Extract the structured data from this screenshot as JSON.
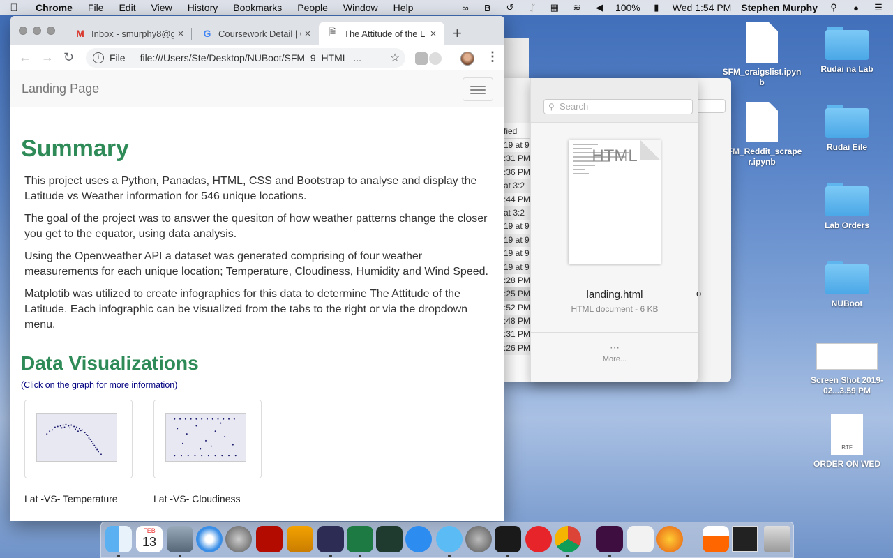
{
  "menubar": {
    "app": "Chrome",
    "items": [
      "File",
      "Edit",
      "View",
      "History",
      "Bookmarks",
      "People",
      "Window",
      "Help"
    ],
    "battery": "100%",
    "clock": "Wed 1:54 PM",
    "user": "Stephen Murphy"
  },
  "browser": {
    "tabs": [
      {
        "title": "Inbox - smurphy8@g",
        "icon": "gmail-icon"
      },
      {
        "title": "Coursework Detail | C",
        "icon": "google-icon"
      },
      {
        "title": "The Attitude of the L",
        "icon": "document-icon"
      }
    ],
    "omnibox": {
      "scheme": "File",
      "url": "file:///Users/Ste/Desktop/NUBoot/SFM_9_HTML_..."
    }
  },
  "page": {
    "brand": "Landing Page",
    "summary_heading": "Summary",
    "paragraphs": [
      "This project uses a Python, Panadas, HTML, CSS and Bootstrap to analyse and display the Latitude vs Weather information for 546 unique locations.",
      "The goal of the project was to answer the quesiton of how weather patterns change the closer you get to the equator, using data analysis.",
      "Using the Openweather API a dataset was generated comprising of four weather measurements for each unique location; Temperature, Cloudiness, Humidity and Wind Speed.",
      "Matplotib was utilized to create infographics for this data to determine The Attitude of the Latitude. Each infographic can be visualized from the tabs to the right or via the dropdown menu."
    ],
    "viz_heading": "Data Visualizations",
    "viz_hint": "(Click on the graph for more information)",
    "cards": [
      {
        "caption": "Lat -VS- Temperature"
      },
      {
        "caption": "Lat -VS- Cloudiness"
      }
    ]
  },
  "finder": {
    "column_header": "fied",
    "rows": [
      "19 at 9",
      ":31 PM",
      ":36 PM",
      " at 3:2",
      ":44 PM",
      " at 3:2",
      "19 at 9",
      "19 at 9",
      "19 at 9",
      "19 at 9",
      ":28 PM",
      ":25 PM",
      ":52 PM",
      ":48 PM",
      ":31 PM",
      ":26 PM"
    ],
    "search_placeholder": "Search",
    "preview_ext": "HTML",
    "file_name": "landing.html",
    "file_info": "HTML document - 6 KB",
    "more_label": "More...",
    "peek_text": "o"
  },
  "desktop": {
    "items": [
      {
        "label": "SFM_craigslist.ipynb",
        "kind": "doc"
      },
      {
        "label": "Rudai na Lab",
        "kind": "folder"
      },
      {
        "label": "SFM_Reddit_scraper.ipynb",
        "kind": "doc"
      },
      {
        "label": "Rudai Eile",
        "kind": "folder"
      },
      {
        "label": "Lab Orders",
        "kind": "folder"
      },
      {
        "label": "NUBoot",
        "kind": "folder"
      },
      {
        "label": "Screen Shot 2019-02...3.59 PM",
        "kind": "screenshot"
      },
      {
        "label": "ORDER ON WED",
        "kind": "rtf"
      }
    ],
    "rtf_badge": "RTF"
  },
  "dock": {
    "calendar_month": "FEB",
    "calendar_day": "13",
    "apps": [
      "finder",
      "calendar",
      "preview",
      "safari",
      "launchpad",
      "acrobat",
      "english-dict",
      "vscode",
      "excel",
      "photos",
      "app-store",
      "messages",
      "system-preferences",
      "terminal",
      "news",
      "chrome",
      "slack",
      "textedit",
      "firefox",
      "vlc",
      "screenshot-window",
      "trash"
    ]
  },
  "colors": {
    "heading": "#2e8b57",
    "hint": "#000080"
  }
}
